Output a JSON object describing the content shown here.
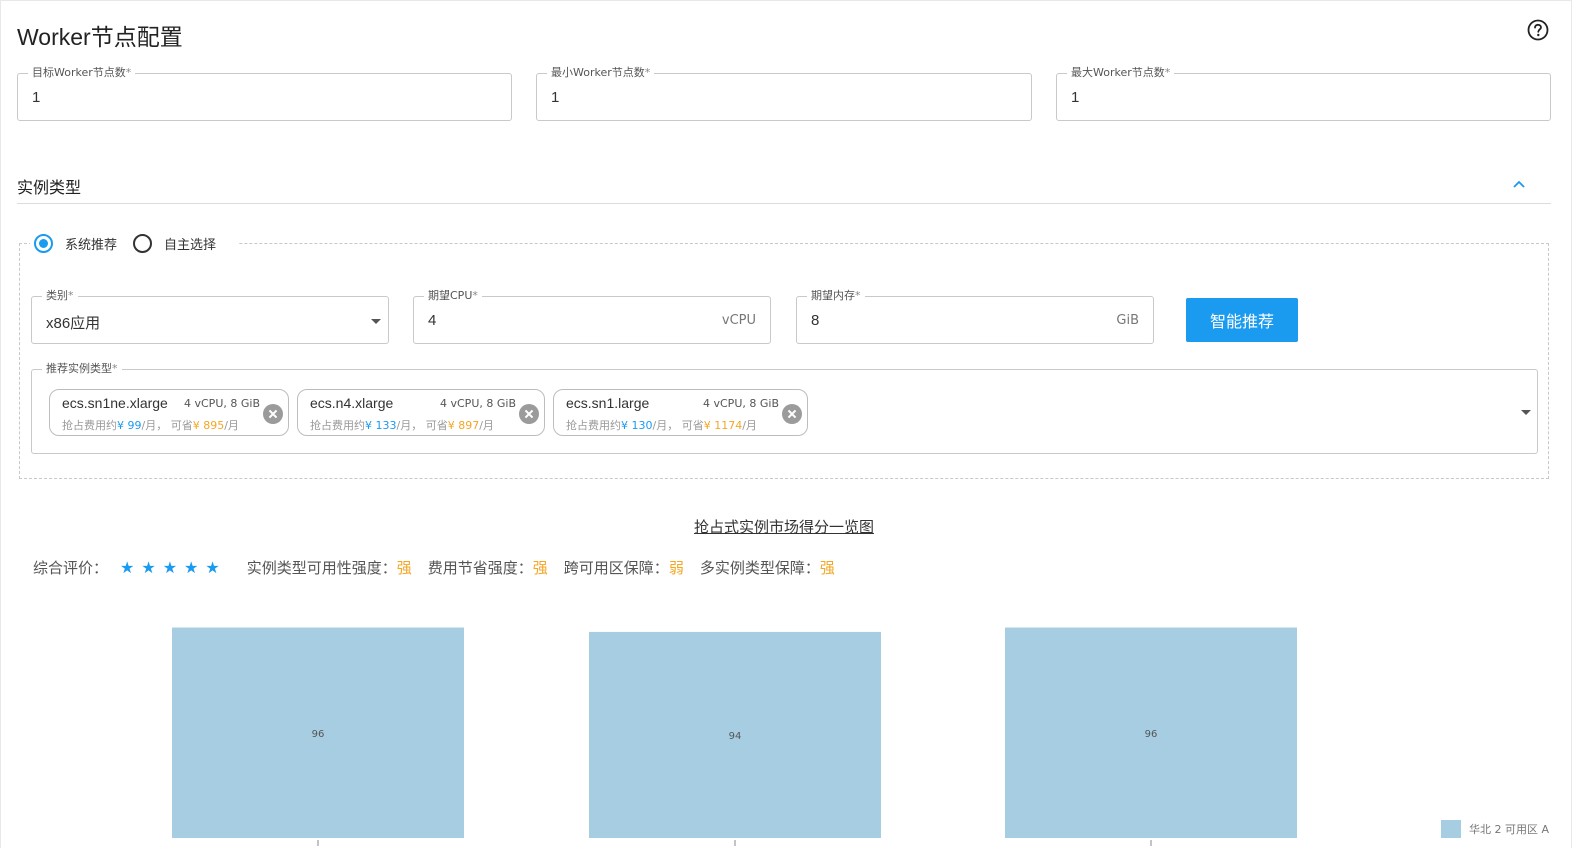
{
  "page": {
    "title": "Worker节点配置"
  },
  "node_counts": [
    {
      "label": "目标Worker节点数",
      "required": "*",
      "value": "1"
    },
    {
      "label": "最小Worker节点数",
      "required": "*",
      "value": "1"
    },
    {
      "label": "最大Worker节点数",
      "required": "*",
      "value": "1"
    }
  ],
  "instance_section": {
    "title": "实例类型",
    "collapse_icon": "chevron-up-icon",
    "help_icon": "question-circle-icon",
    "modes": [
      {
        "label": "系统推荐",
        "selected": true
      },
      {
        "label": "自主选择",
        "selected": false
      }
    ]
  },
  "filters": {
    "category": {
      "label": "类别",
      "required": "*",
      "value": "x86应用"
    },
    "cpu": {
      "label": "期望CPU",
      "required": "*",
      "value": "4",
      "unit": "vCPU"
    },
    "memory": {
      "label": "期望内存",
      "required": "*",
      "value": "8",
      "unit": "GiB"
    },
    "recommend_button": "智能推荐"
  },
  "recommended": {
    "label": "推荐实例类型",
    "required": "*",
    "chips": [
      {
        "name": "ecs.sn1ne.xlarge",
        "spec": "4 vCPU, 8 GiB",
        "price_prefix": "抢占费用约",
        "price": "¥ 99",
        "price_unit": "/月，",
        "save_prefix": "可省",
        "save": "¥ 895",
        "save_unit": "/月"
      },
      {
        "name": "ecs.n4.xlarge",
        "spec": "4 vCPU, 8 GiB",
        "price_prefix": "抢占费用约",
        "price": "¥ 133",
        "price_unit": "/月，",
        "save_prefix": "可省",
        "save": "¥ 897",
        "save_unit": "/月"
      },
      {
        "name": "ecs.sn1.large",
        "spec": "4 vCPU, 8 GiB",
        "price_prefix": "抢占费用约",
        "price": "¥ 130",
        "price_unit": "/月，",
        "save_prefix": "可省",
        "save": "¥ 1174",
        "save_unit": "/月"
      }
    ]
  },
  "market": {
    "title": "抢占式实例市场得分一览图",
    "overall_label": "综合评价：",
    "stars": "★★★★★",
    "star_count": 5,
    "metrics": [
      {
        "label": "实例类型可用性强度：",
        "value": "强"
      },
      {
        "label": "费用节省强度：",
        "value": "强"
      },
      {
        "label": "跨可用区保障：",
        "value": "弱"
      },
      {
        "label": "多实例类型保障：",
        "value": "强"
      }
    ]
  },
  "chart_data": {
    "type": "bar",
    "series": [
      {
        "name": "华北 2 可用区 A",
        "values": [
          96,
          94,
          96
        ]
      }
    ],
    "data_labels": [
      "96",
      "94",
      "96"
    ],
    "ylim": [
      0,
      104
    ],
    "grid": false,
    "legend_position": "bottom-right",
    "color": "#a7cde2"
  },
  "colors": {
    "primary": "#1a9bf0",
    "accent": "#f5a623",
    "bar": "#a7cde2"
  }
}
